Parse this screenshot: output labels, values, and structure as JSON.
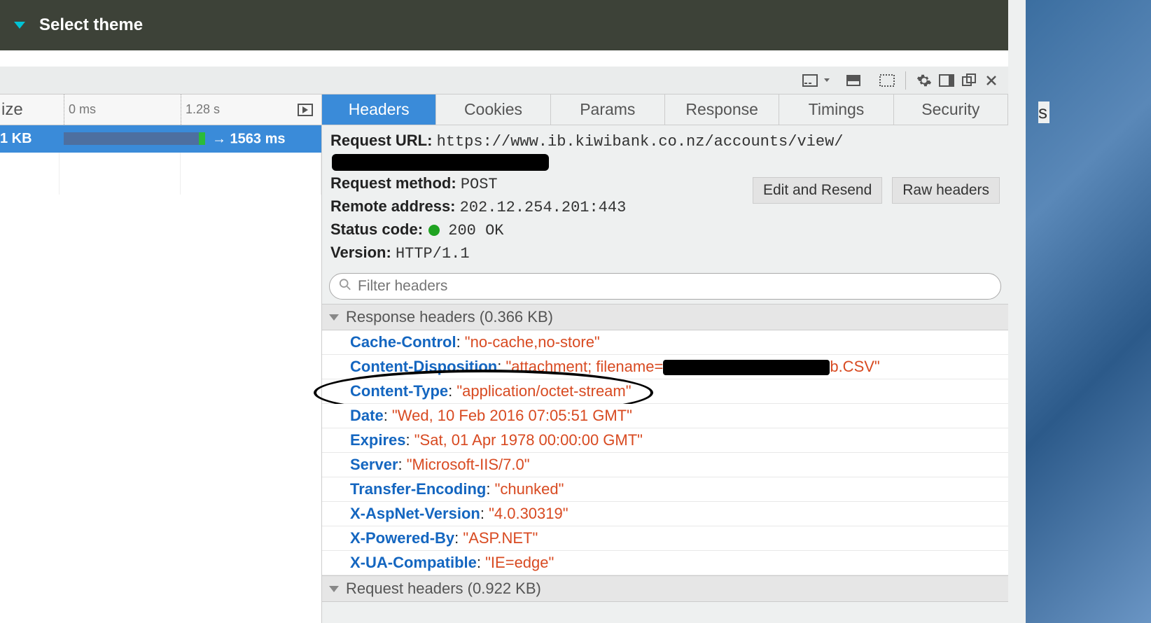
{
  "header": {
    "title": "Select theme"
  },
  "toolbar": {
    "icons": [
      "panel-toggle-icon",
      "split-view-icon",
      "responsive-icon",
      "gear-icon",
      "dock-side-icon",
      "popout-icon",
      "close-icon"
    ]
  },
  "timeline": {
    "size_label": "ize",
    "tick0": "0 ms",
    "tick1": "1.28 s"
  },
  "request_row": {
    "size": "1 KB",
    "duration": "→ 1563 ms"
  },
  "tabs": [
    "Headers",
    "Cookies",
    "Params",
    "Response",
    "Timings",
    "Security"
  ],
  "summary": {
    "url_label": "Request URL:",
    "url_value": "https://www.ib.kiwibank.co.nz/accounts/view/",
    "method_label": "Request method:",
    "method_value": "POST",
    "remote_label": "Remote address:",
    "remote_value": "202.12.254.201:443",
    "status_label": "Status code:",
    "status_value": "200 OK",
    "version_label": "Version:",
    "version_value": "HTTP/1.1"
  },
  "buttons": {
    "edit_resend": "Edit and Resend",
    "raw_headers": "Raw headers"
  },
  "filter": {
    "placeholder": "Filter headers"
  },
  "sections": {
    "response_hdr": "Response headers (0.366 KB)",
    "request_hdr": "Request headers (0.922 KB)"
  },
  "response_headers": [
    {
      "name": "Cache-Control",
      "value": "\"no-cache,no-store\""
    },
    {
      "name": "Content-Disposition",
      "value_pre": "\"attachment; filename=",
      "value_post": "b.CSV\"",
      "redacted": true
    },
    {
      "name": "Content-Type",
      "value": "\"application/octet-stream\"",
      "circled": true
    },
    {
      "name": "Date",
      "value": "\"Wed, 10 Feb 2016 07:05:51 GMT\""
    },
    {
      "name": "Expires",
      "value": "\"Sat, 01 Apr 1978 00:00:00 GMT\""
    },
    {
      "name": "Server",
      "value": "\"Microsoft-IIS/7.0\""
    },
    {
      "name": "Transfer-Encoding",
      "value": "\"chunked\""
    },
    {
      "name": "X-AspNet-Version",
      "value": "\"4.0.30319\""
    },
    {
      "name": "X-Powered-By",
      "value": "\"ASP.NET\""
    },
    {
      "name": "X-UA-Compatible",
      "value": "\"IE=edge\""
    }
  ],
  "right_strip_char": "s"
}
